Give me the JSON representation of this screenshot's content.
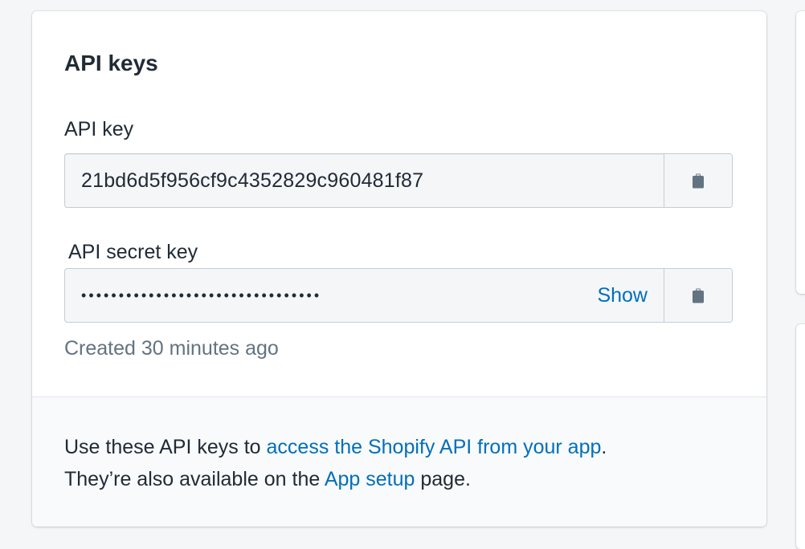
{
  "card": {
    "title": "API keys",
    "api_key": {
      "label": "API key",
      "value": "21bd6d5f956cf9c4352829c960481f87",
      "copy_icon": "clipboard-icon"
    },
    "secret_key": {
      "label": "API secret key",
      "masked_value": "••••••••••••••••••••••••••••••••",
      "show_label": "Show",
      "copy_icon": "clipboard-icon"
    },
    "created": "Created 30 minutes ago"
  },
  "footer": {
    "text_1": "Use these API keys to ",
    "link_1": "access the Shopify API from your app",
    "text_2": ".",
    "text_3": "They’re also available on the ",
    "link_2": "App setup",
    "text_4": " page."
  },
  "colors": {
    "link": "#006fbb",
    "text": "#212b36",
    "subdued": "#637381",
    "field_bg": "#f4f6f8",
    "border": "#c4cdd5"
  }
}
